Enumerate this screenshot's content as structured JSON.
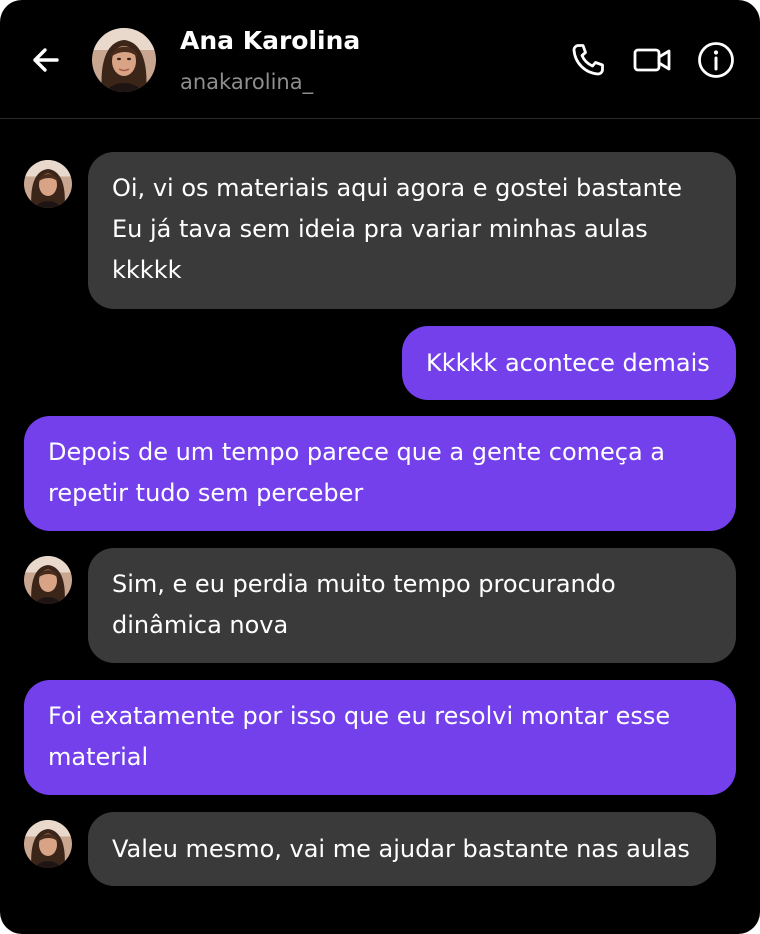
{
  "header": {
    "name": "Ana Karolina",
    "handle": "anakarolina_",
    "icons": [
      "back-arrow-icon",
      "phone-icon",
      "video-camera-icon",
      "info-icon"
    ]
  },
  "colors": {
    "background": "#000000",
    "incoming_bubble": "#3a3a3a",
    "outgoing_bubble": "#7440ec",
    "text": "#ffffff",
    "handle_text": "#8e8e8e"
  },
  "messages": [
    {
      "direction": "incoming",
      "lines": [
        "Oi, vi os materiais aqui agora e gostei bastante",
        "Eu já tava sem ideia pra variar minhas aulas",
        "kkkkk"
      ]
    },
    {
      "direction": "outgoing",
      "lines": [
        "Kkkkk acontece demais"
      ]
    },
    {
      "direction": "outgoing",
      "lines": [
        "Depois de um tempo parece que a gente começa a",
        "repetir tudo sem perceber"
      ]
    },
    {
      "direction": "incoming",
      "lines": [
        "Sim, e eu perdia muito tempo procurando",
        "dinâmica nova"
      ]
    },
    {
      "direction": "outgoing",
      "lines": [
        "Foi exatamente por isso que eu resolvi montar esse",
        "material"
      ]
    },
    {
      "direction": "incoming",
      "lines": [
        "Valeu mesmo, vai me ajudar bastante nas aulas"
      ]
    }
  ]
}
